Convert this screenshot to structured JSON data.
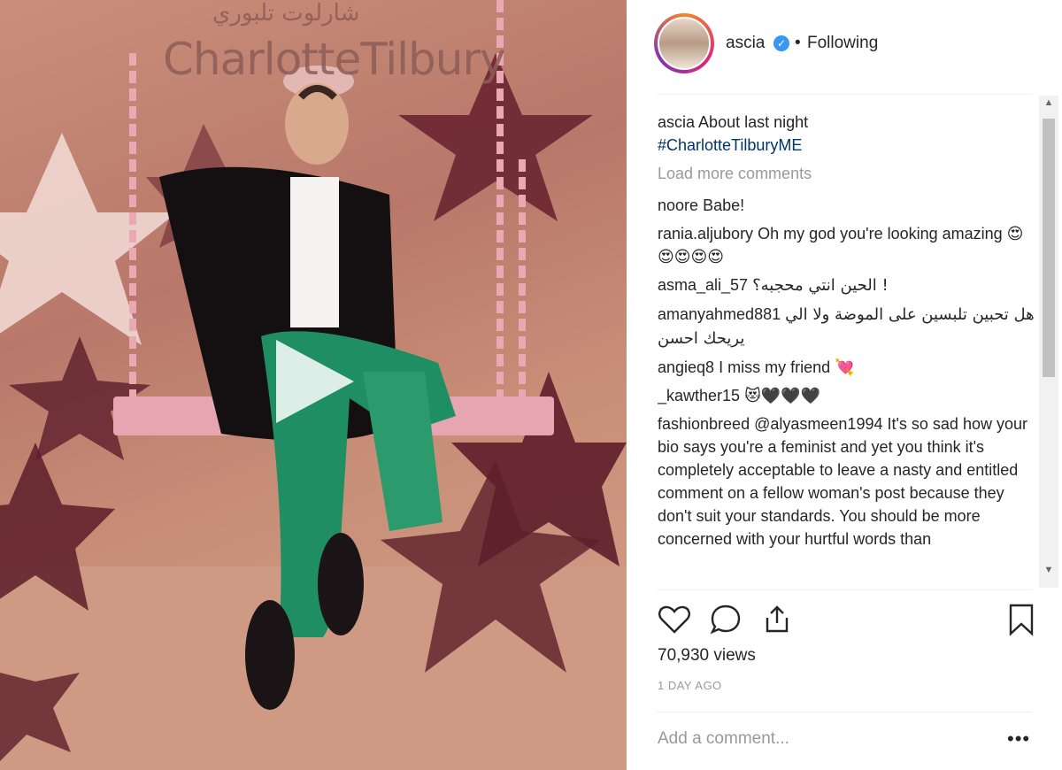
{
  "media": {
    "brand_arabic": "شارلوت تلبوري",
    "brand_text": "CharlotteTilbury"
  },
  "post": {
    "username": "ascia",
    "verified_icon": "verified-badge-icon",
    "separator": "•",
    "follow_status": "Following",
    "caption_user": "ascia",
    "caption_text": "About last night",
    "caption_hashtag": "#CharlotteTilburyME",
    "load_more": "Load more comments",
    "comments": [
      {
        "user": "noore",
        "text": "Babe!"
      },
      {
        "user": "rania.aljubory",
        "text": "Oh my god you're looking amazing 😍😍😍😍😍"
      },
      {
        "user": "asma_ali_57",
        "text": "الحين انتي محجبه؟ !"
      },
      {
        "user": "amanyahmed881",
        "text": "هل تحبين تلبسين على الموضة ولا الي يريحك احسن"
      },
      {
        "user": "angieq8",
        "text": "I miss my friend 💘"
      },
      {
        "user": "_kawther15",
        "text": "😻🖤🖤🖤"
      },
      {
        "user": "fashionbreed",
        "text": "@alyasmeen1994 It's so sad how your bio says you're a feminist and yet you think it's completely acceptable to leave a nasty and entitled comment on a fellow woman's post because they don't suit your standards. You should be more concerned with your hurtful words than"
      }
    ],
    "views": "70,930 views",
    "time": "1 DAY AGO",
    "add_comment_placeholder": "Add a comment...",
    "more_label": "•••"
  },
  "colors": {
    "verified": "#3897f0",
    "hashtag": "#003569",
    "muted": "#999999"
  }
}
